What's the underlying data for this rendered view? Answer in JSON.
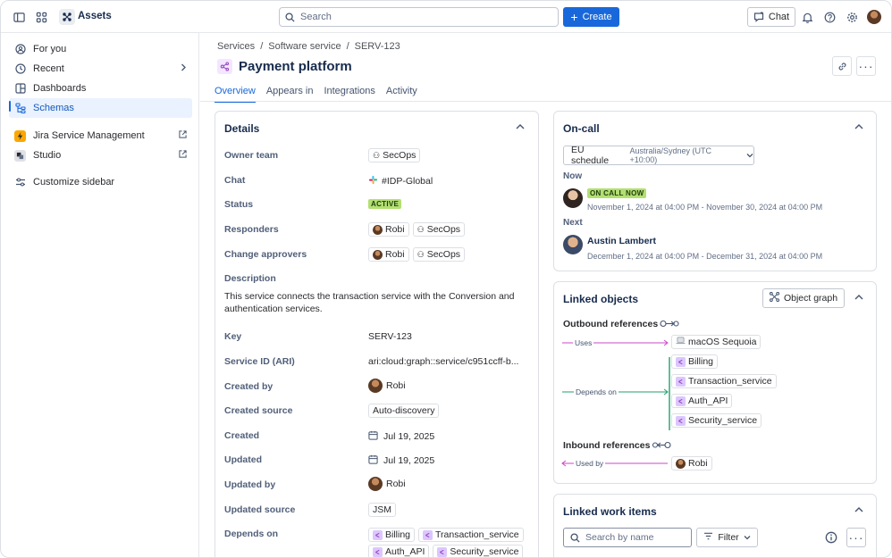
{
  "topbar": {
    "app_name": "Assets",
    "search_placeholder": "Search",
    "create_label": "Create",
    "chat_label": "Chat"
  },
  "sidebar": {
    "items": [
      {
        "label": "For you",
        "icon": "user-circle-icon"
      },
      {
        "label": "Recent",
        "icon": "clock-icon"
      },
      {
        "label": "Dashboards",
        "icon": "dashboard-icon"
      },
      {
        "label": "Schemas",
        "icon": "schema-icon"
      },
      {
        "label": "Jira Service Management",
        "icon": "jsm-icon"
      },
      {
        "label": "Studio",
        "icon": "studio-icon"
      },
      {
        "label": "Customize sidebar",
        "icon": "sliders-icon"
      }
    ]
  },
  "breadcrumb": {
    "items": [
      "Services",
      "Software service",
      "SERV-123"
    ],
    "separator": "/"
  },
  "page": {
    "title": "Payment platform",
    "tabs": [
      "Overview",
      "Appears in",
      "Integrations",
      "Activity"
    ]
  },
  "details": {
    "title": "Details",
    "owner_team_label": "Owner team",
    "owner_team": "SecOps",
    "chat_label": "Chat",
    "chat": "#IDP-Global",
    "status_label": "Status",
    "status": "ACTIVE",
    "responders_label": "Responders",
    "responder_1": "Robi",
    "responder_2": "SecOps",
    "approvers_label": "Change approvers",
    "approver_1": "Robi",
    "approver_2": "SecOps",
    "description_label": "Description",
    "description": "This service connects the transaction service with the Conversion and authentication services.",
    "key_label": "Key",
    "key": "SERV-123",
    "service_id_label": "Service ID (ARI)",
    "service_id": "ari:cloud:graph::service/c951ccff-b...",
    "created_by_label": "Created by",
    "created_by": "Robi",
    "created_source_label": "Created source",
    "created_source": "Auto-discovery",
    "created_label": "Created",
    "created": "Jul 19, 2025",
    "updated_label": "Updated",
    "updated": "Jul 19, 2025",
    "updated_by_label": "Updated by",
    "updated_by": "Robi",
    "updated_source_label": "Updated source",
    "updated_source": "JSM",
    "depends_on_label": "Depends on",
    "depends_on": [
      "Billing",
      "Transaction_service",
      "Auth_API",
      "Security_service"
    ]
  },
  "oncall": {
    "title": "On-call",
    "schedule": "EU schedule",
    "timezone": "Australia/Sydney (UTC +10:00)",
    "now_label": "Now",
    "now_badge": "ON CALL NOW",
    "now_range": "November 1, 2024 at 04:00 PM - November 30, 2024 at 04:00 PM",
    "next_label": "Next",
    "next_name": "Austin Lambert",
    "next_range": "December 1, 2024 at 04:00 PM - December 31, 2024 at 04:00 PM"
  },
  "linked_objects": {
    "title": "Linked objects",
    "graph_button": "Object graph",
    "outbound_label": "Outbound references",
    "uses_label": "Uses",
    "uses_target": "macOS Sequoia",
    "depends_label": "Depends on",
    "depends_targets": [
      "Billing",
      "Transaction_service",
      "Auth_API",
      "Security_service"
    ],
    "inbound_label": "Inbound references",
    "used_by_label": "Used by",
    "used_by_target": "Robi"
  },
  "work_items": {
    "title": "Linked work items",
    "search_placeholder": "Search by name",
    "filter_label": "Filter"
  },
  "colors": {
    "accent": "#1868db",
    "status_active": "#b3df72",
    "depends_line": "#22a06b",
    "uses_line": "#c94ac4"
  }
}
